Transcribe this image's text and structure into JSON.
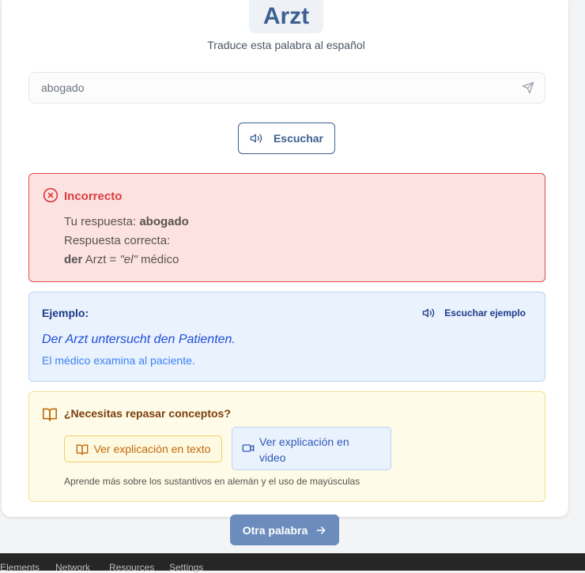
{
  "word": {
    "text": "Arzt"
  },
  "instruction": "Traduce esta palabra al español",
  "answer_input": {
    "value": "abogado"
  },
  "listen_button": {
    "label": "Escuchar"
  },
  "feedback": {
    "title": "Incorrecto",
    "your_answer_label": "Tu respuesta:",
    "your_answer_value": "abogado",
    "correct_answer_label": "Respuesta correcta:",
    "article": "der",
    "noun_equals": "Arzt =",
    "es_article": "\"el\"",
    "es_noun": "médico"
  },
  "example": {
    "label": "Ejemplo:",
    "listen_label": "Escuchar ejemplo",
    "german": "Der Arzt untersucht den Patienten.",
    "spanish": "El médico examina al paciente."
  },
  "review": {
    "title": "¿Necesitas repasar conceptos?",
    "text_button": "Ver explicación en texto",
    "video_button": "Ver explicación en video",
    "note": "Aprende más sobre los sustantivos en alemán y el uso de mayúsculas"
  },
  "next_button": {
    "label": "Otra palabra"
  },
  "devtools": {
    "tabs": [
      "Elements",
      "Network",
      "Resources",
      "Settings"
    ]
  },
  "colors": {
    "primary": "#3d5f91",
    "error": "#dc3d3d",
    "example_text": "#1d4ed8",
    "review_title": "#7c3d0c"
  },
  "icons": [
    "send-icon",
    "speaker-icon",
    "x-circle-icon",
    "book-open-icon",
    "video-icon",
    "arrow-right-icon"
  ]
}
